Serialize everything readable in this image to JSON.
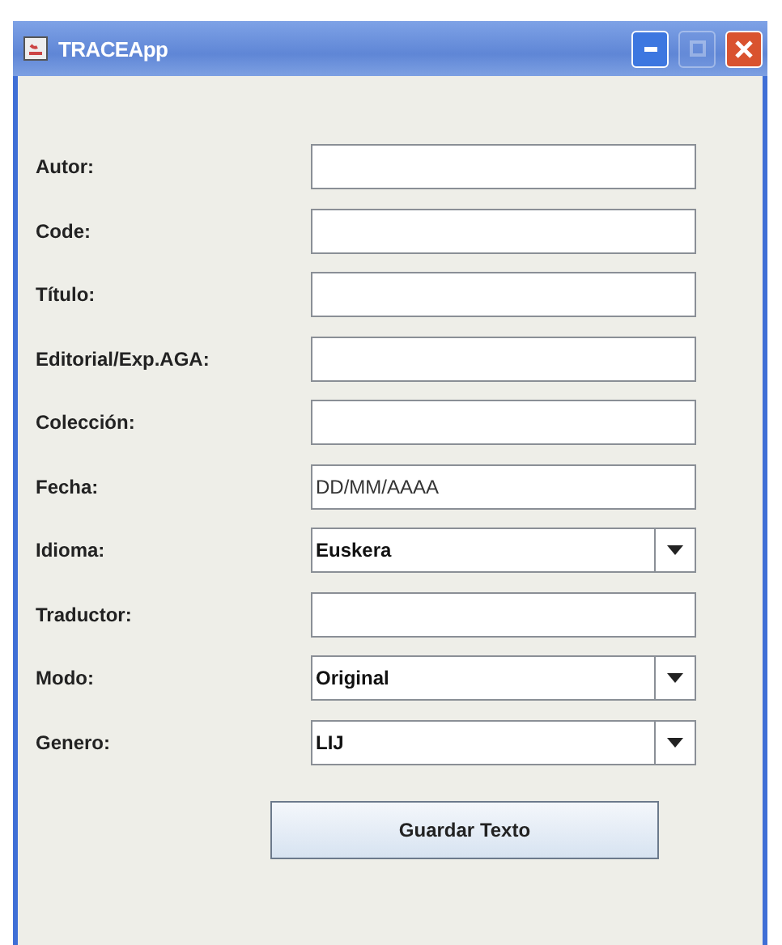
{
  "window": {
    "title": "TRACEApp",
    "minimize": {
      "disabled": false
    },
    "maximize": {
      "disabled": true
    }
  },
  "fields": [
    {
      "label": "Autor:",
      "kind": "text"
    },
    {
      "label": "Code:",
      "kind": "text"
    },
    {
      "label": "Título:",
      "kind": "text"
    },
    {
      "label": "Editorial/Exp.AGA:",
      "kind": "text"
    },
    {
      "label": "Colección:",
      "kind": "text"
    },
    {
      "label": "Fecha:",
      "kind": "text",
      "value": "DD/MM/AAAA"
    },
    {
      "label": "Idioma:",
      "kind": "combo",
      "value": "Euskera"
    },
    {
      "label": "Traductor:",
      "kind": "text"
    },
    {
      "label": "Modo:",
      "kind": "combo",
      "value": "Original"
    },
    {
      "label": "Genero:",
      "kind": "combo",
      "value": "LIJ"
    }
  ],
  "button": "Guardar Texto"
}
